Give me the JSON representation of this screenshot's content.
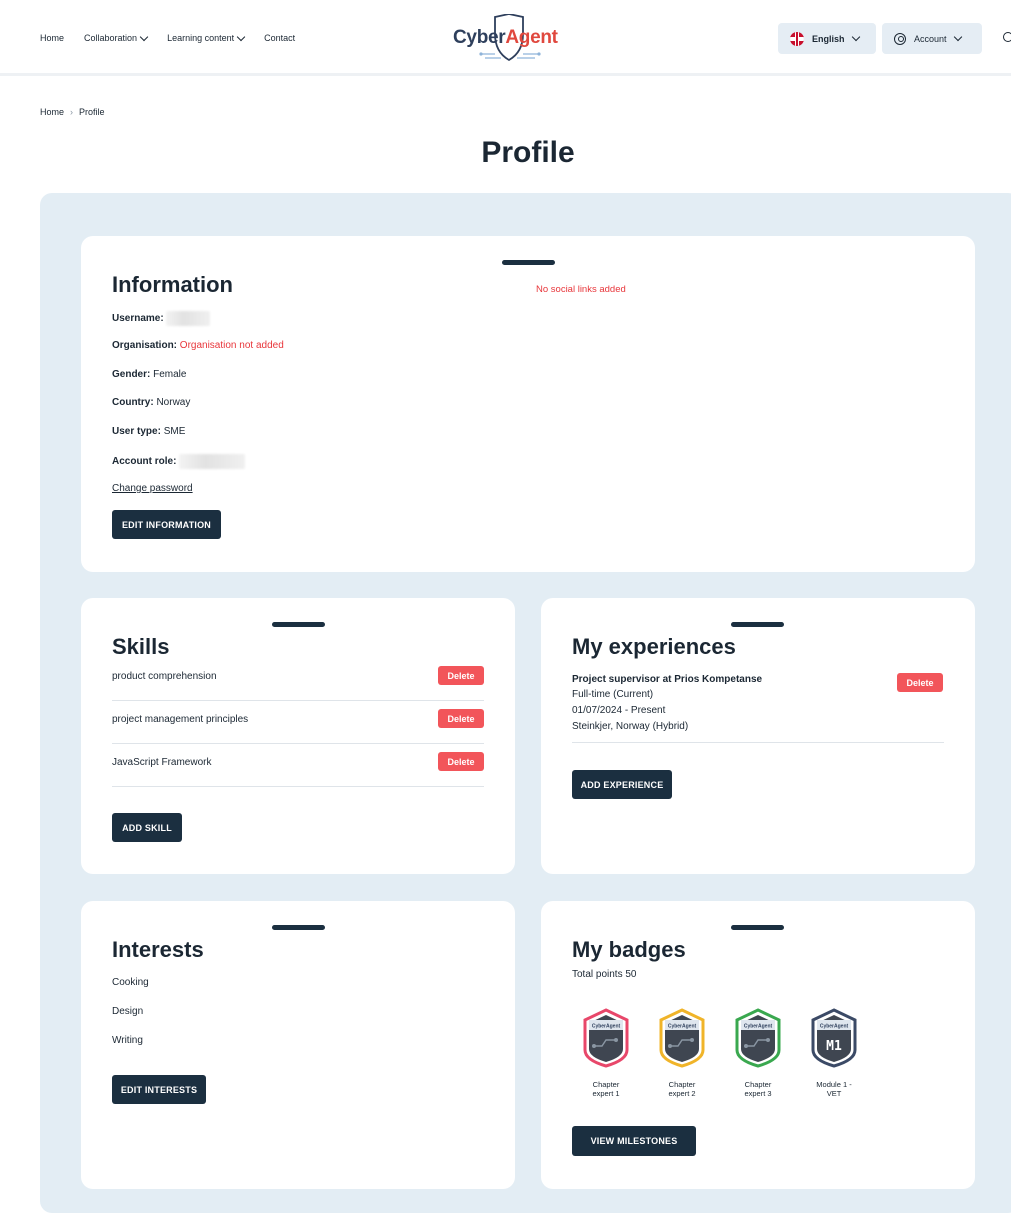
{
  "header": {
    "nav": [
      {
        "label": "Home",
        "has_dropdown": false
      },
      {
        "label": "Collaboration",
        "has_dropdown": true
      },
      {
        "label": "Learning content",
        "has_dropdown": true
      },
      {
        "label": "Contact",
        "has_dropdown": false
      }
    ],
    "logo_part1": "Cyber",
    "logo_part2": "Agent",
    "language": "English",
    "account": "Account"
  },
  "breadcrumb": [
    "Home",
    "Profile"
  ],
  "page_title": "Profile",
  "information": {
    "title": "Information",
    "social": "No social links added",
    "fields": [
      {
        "label": "Username:",
        "value": ""
      },
      {
        "label": "Organisation:",
        "value": "Organisation not added"
      },
      {
        "label": "Gender:",
        "value": "Female"
      },
      {
        "label": "Country:",
        "value": "Norway"
      },
      {
        "label": "User type:",
        "value": "SME"
      },
      {
        "label": "Account role:",
        "value": ""
      }
    ],
    "change_password": "Change password",
    "edit_button": "EDIT INFORMATION"
  },
  "skills": {
    "title": "Skills",
    "items": [
      "product comprehension",
      "project management principles",
      "JavaScript Framework"
    ],
    "delete_label": "Delete",
    "add_button": "ADD SKILL"
  },
  "experiences": {
    "title": "My experiences",
    "items": [
      {
        "title": "Project supervisor at Prios Kompetanse",
        "type": "Full-time (Current)",
        "dates": "01/07/2024 - Present",
        "location": "Steinkjer, Norway (Hybrid)"
      }
    ],
    "delete_label": "Delete",
    "add_button": "ADD EXPERIENCE"
  },
  "interests": {
    "title": "Interests",
    "items": [
      "Cooking",
      "Design",
      "Writing"
    ],
    "edit_button": "EDIT INTERESTS"
  },
  "badges": {
    "title": "My badges",
    "total": "Total points 50",
    "badge_logo": "CyberAgent",
    "items": [
      {
        "line1": "Chapter",
        "line2": "expert 1",
        "color": "#e8476a",
        "mark": ""
      },
      {
        "line1": "Chapter",
        "line2": "expert 2",
        "color": "#f0b429",
        "mark": ""
      },
      {
        "line1": "Chapter",
        "line2": "expert 3",
        "color": "#3aa84f",
        "mark": ""
      },
      {
        "line1": "Module 1 -",
        "line2": "VET",
        "color": "#3b4a66",
        "mark": "M1"
      }
    ],
    "milestones_button": "VIEW MILESTONES"
  }
}
